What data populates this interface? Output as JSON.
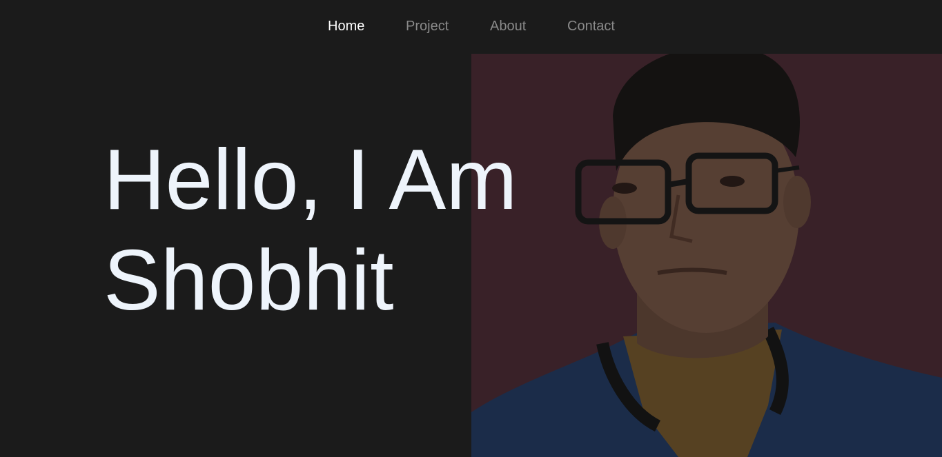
{
  "nav": {
    "items": [
      {
        "label": "Home",
        "active": true
      },
      {
        "label": "Project",
        "active": false
      },
      {
        "label": "About",
        "active": false
      },
      {
        "label": "Contact",
        "active": false
      }
    ],
    "active_color": "#ffffff",
    "inactive_color": "#8a8a8a"
  },
  "hero": {
    "line1": "Hello, I Am",
    "line2": "Shobhit"
  },
  "portrait": {
    "icon": "portrait-photo",
    "background_color": "#4a2a33"
  },
  "colors": {
    "page_background": "#1b1b1b",
    "hero_text": "#eef4fb"
  }
}
